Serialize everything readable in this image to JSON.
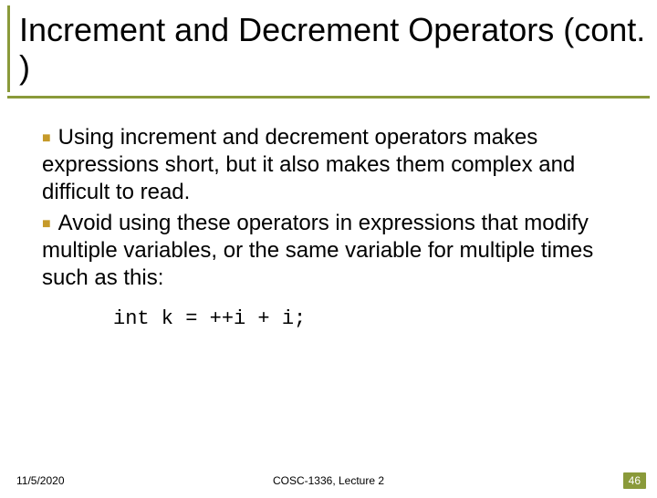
{
  "title": "Increment and Decrement Operators (cont. )",
  "bullets": [
    "Using increment and decrement operators makes expressions short, but it also makes them complex and difficult to read.",
    "Avoid using these operators in expressions that modify multiple variables, or the same variable for multiple times such as this:"
  ],
  "code": "int k = ++i + i;",
  "footer": {
    "date": "11/5/2020",
    "center": "COSC-1336, Lecture 2",
    "pageno": "46"
  }
}
